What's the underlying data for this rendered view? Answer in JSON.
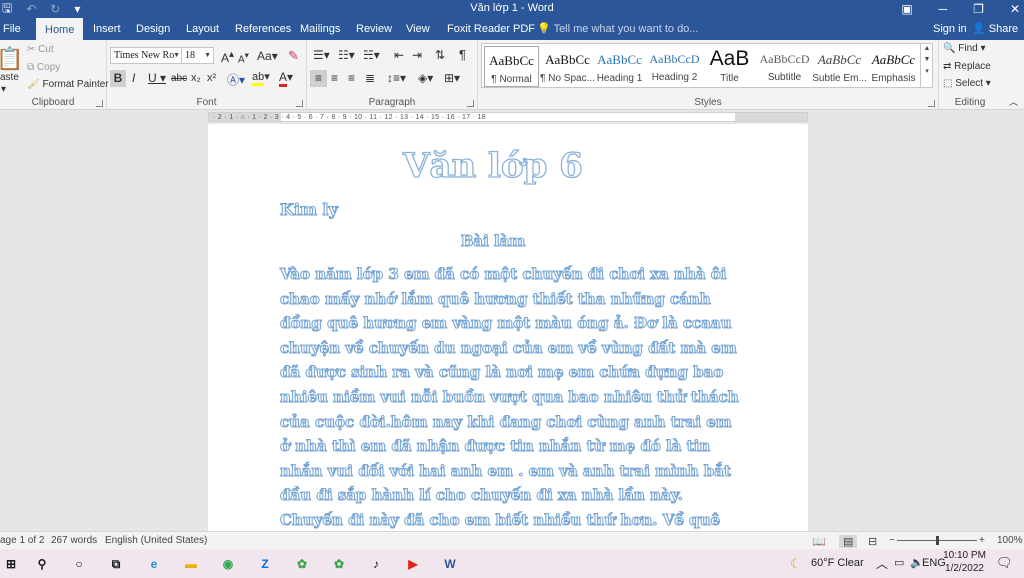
{
  "window": {
    "title": "Văn lớp 1 - Word",
    "qat": {
      "save_icon": "save-icon",
      "undo_icon": "undo-icon",
      "redo_icon": "redo-icon",
      "customize_icon": "customize-qat-icon"
    },
    "controls": {
      "restore_icon": "ribbon-display-icon",
      "minimize_icon": "minimize-icon",
      "maximize_icon": "restore-icon",
      "close_icon": "close-icon"
    }
  },
  "tabs": [
    {
      "label": "File"
    },
    {
      "label": "Home"
    },
    {
      "label": "Insert"
    },
    {
      "label": "Design"
    },
    {
      "label": "Layout"
    },
    {
      "label": "References"
    },
    {
      "label": "Mailings"
    },
    {
      "label": "Review"
    },
    {
      "label": "View"
    },
    {
      "label": "Foxit Reader PDF"
    }
  ],
  "active_tab": "Home",
  "tell_me": "Tell me what you want to do...",
  "account": {
    "sign_in": "Sign in",
    "share": "Share"
  },
  "ribbon": {
    "clipboard": {
      "label": "Clipboard",
      "paste": "aste",
      "cut": "Cut",
      "copy": "Copy",
      "format_painter": "Format Painter"
    },
    "font": {
      "label": "Font",
      "font_name": "Times New Ro",
      "font_size": "18",
      "grow": "A",
      "shrink": "A",
      "change_case": "Aa",
      "bold": "B",
      "italic": "I",
      "underline": "U",
      "strikethrough": "abc",
      "subscript": "x₂",
      "superscript": "x²",
      "font_color_letter": "A",
      "highlight_letter": "ab",
      "font_color": "#e02020",
      "highlight_color": "#ffff00"
    },
    "paragraph": {
      "label": "Paragraph",
      "pilcrow": "¶"
    },
    "styles": {
      "label": "Styles",
      "items": [
        {
          "preview": "AaBbCc",
          "name": "¶ Normal"
        },
        {
          "preview": "AaBbCc",
          "name": "¶ No Spac..."
        },
        {
          "preview": "AaBbCc",
          "name": "Heading 1"
        },
        {
          "preview": "AaBbCcD",
          "name": "Heading 2"
        },
        {
          "preview": "AaB",
          "name": "Title"
        },
        {
          "preview": "AaBbCcD",
          "name": "Subtitle"
        },
        {
          "preview": "AaBbCc",
          "name": "Subtle Em..."
        },
        {
          "preview": "AaBbCc",
          "name": "Emphasis"
        }
      ]
    },
    "editing": {
      "label": "Editing",
      "find": "Find",
      "replace": "Replace",
      "select": "Select"
    }
  },
  "ruler": {
    "ticks": "· 2 · 1 · ⌂ · 1 · 2 · 3 · 4 · 5 · 6 · 7 · 8 · 9 · 10 · 11 · 12 · 13 · 14 · 15 · 16 · 17 · 18"
  },
  "document": {
    "title": "Văn lớp 6",
    "author": "Kim ly",
    "heading": "Bài làm",
    "body_lines": [
      "Vào năm lớp 3 em đã có một chuyến đi chơi xa nhà ôi",
      "chao mấy nhớ lắm quê hương thiết tha những cánh",
      "đồng quê hương em vàng một màu óng ả. Đơ là ccaau",
      "chuyện về chuyến du ngoại của em về vùng đất mà em",
      "đã được sinh ra và cũng là nơi mẹ em chứa đựng bao",
      "nhiêu niềm vui nỗi buồn vượt qua bao nhiêu thử thách",
      "của cuộc đời.hôm nay khi đang chơi cùng anh trai em",
      "ở nhà thì em đã nhận được tin nhắn từ mẹ đó là tin",
      "nhắn vui đối với hai anh em . em và anh trai mình bắt",
      "đầu đi sắp hành lí cho chuyến đi xa nhà lần này.",
      "Chuyến đi này đã cho em biết nhiều thứ hơn. Về quê"
    ]
  },
  "status": {
    "page": "age 1 of 2",
    "words": "267 words",
    "language": "English (United States)",
    "zoom": "100%",
    "zoom_level_percent": 100
  },
  "taskbar": {
    "apps": [
      {
        "icon": "windows-start-icon",
        "glyph": "⊞",
        "color": "#1a1a1a"
      },
      {
        "icon": "search-icon",
        "glyph": "⚲",
        "color": "#1a1a1a"
      },
      {
        "icon": "cortana-icon",
        "glyph": "○",
        "color": "#1a1a1a"
      },
      {
        "icon": "task-view-icon",
        "glyph": "⧉",
        "color": "#1a1a1a"
      },
      {
        "icon": "edge-icon",
        "glyph": "e",
        "color": "#1f8fd6"
      },
      {
        "icon": "file-explorer-icon",
        "glyph": "▬",
        "color": "#e8b100"
      },
      {
        "icon": "chrome-icon",
        "glyph": "◉",
        "color": "#34a853"
      },
      {
        "icon": "zalo-icon",
        "glyph": "Z",
        "color": "#0a6ee0"
      },
      {
        "icon": "green-app-icon",
        "glyph": "✿",
        "color": "#3aa64a"
      },
      {
        "icon": "tiktok-icon",
        "glyph": "♪",
        "color": "#111111"
      },
      {
        "icon": "youtube-icon",
        "glyph": "▶",
        "color": "#e62117"
      },
      {
        "icon": "word-icon",
        "glyph": "W",
        "color": "#2b579a"
      }
    ],
    "weather": "60°F  Clear",
    "language": "ENG",
    "time": "10:10 PM",
    "date": "1/2/2022"
  }
}
